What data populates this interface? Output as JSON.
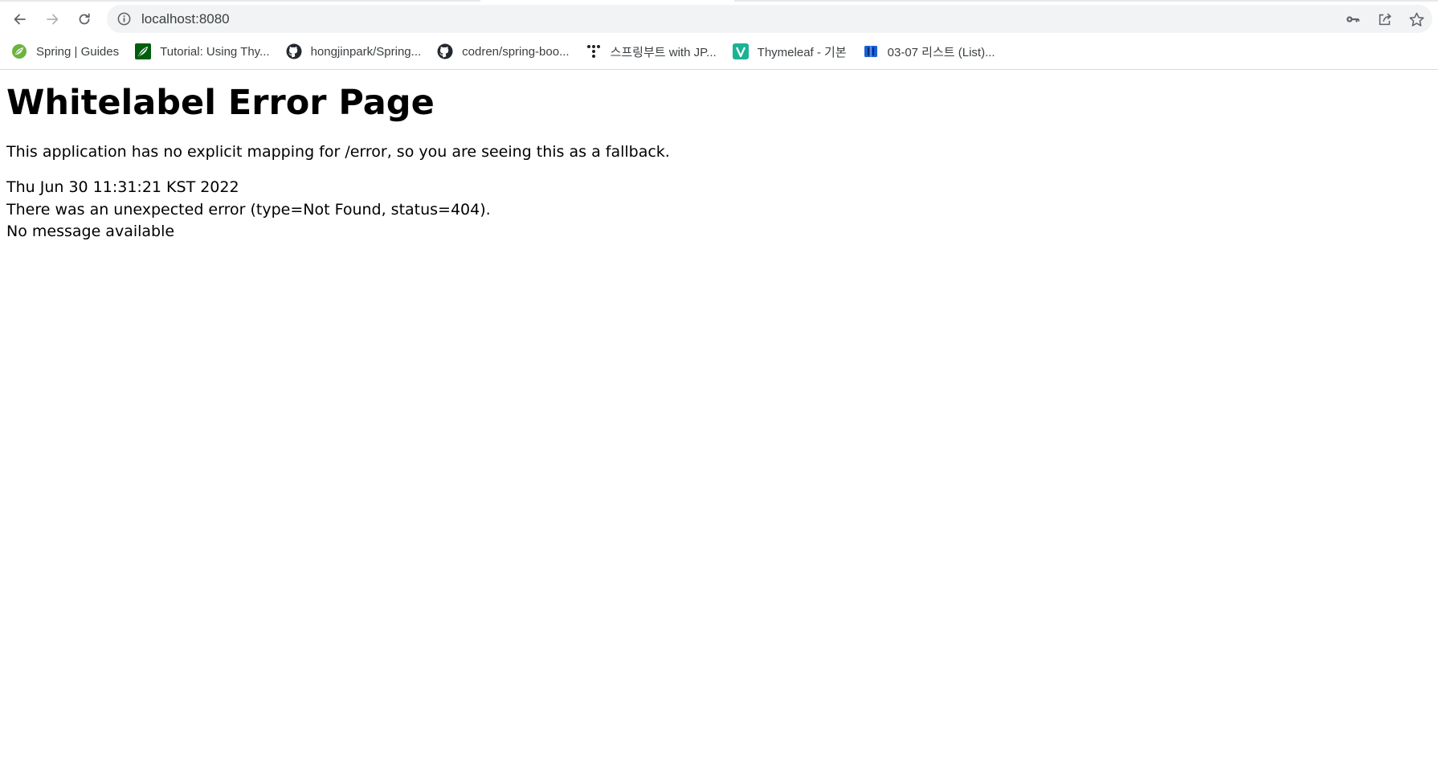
{
  "browser": {
    "url": "localhost:8080",
    "bookmarks": [
      {
        "label": "Spring | Guides",
        "icon": "spring-leaf-icon"
      },
      {
        "label": "Tutorial: Using Thy...",
        "icon": "thymeleaf-icon"
      },
      {
        "label": "hongjinpark/Spring...",
        "icon": "github-icon"
      },
      {
        "label": "codren/spring-boo...",
        "icon": "github-icon"
      },
      {
        "label": "스프링부트 with JP...",
        "icon": "dots-icon"
      },
      {
        "label": "Thymeleaf - 기본",
        "icon": "v-icon"
      },
      {
        "label": "03-07 리스트 (List)...",
        "icon": "book-icon"
      }
    ]
  },
  "page": {
    "title": "Whitelabel Error Page",
    "description": "This application has no explicit mapping for /error, so you are seeing this as a fallback.",
    "timestamp": "Thu Jun 30 11:31:21 KST 2022",
    "error_line": "There was an unexpected error (type=Not Found, status=404).",
    "message": "No message available"
  },
  "colors": {
    "omnibox_bg": "#f1f3f4",
    "spring_green": "#6db33f",
    "thymeleaf_green": "#005f0f",
    "v_teal": "#1ab394",
    "book_blue": "#1a5fd6"
  }
}
